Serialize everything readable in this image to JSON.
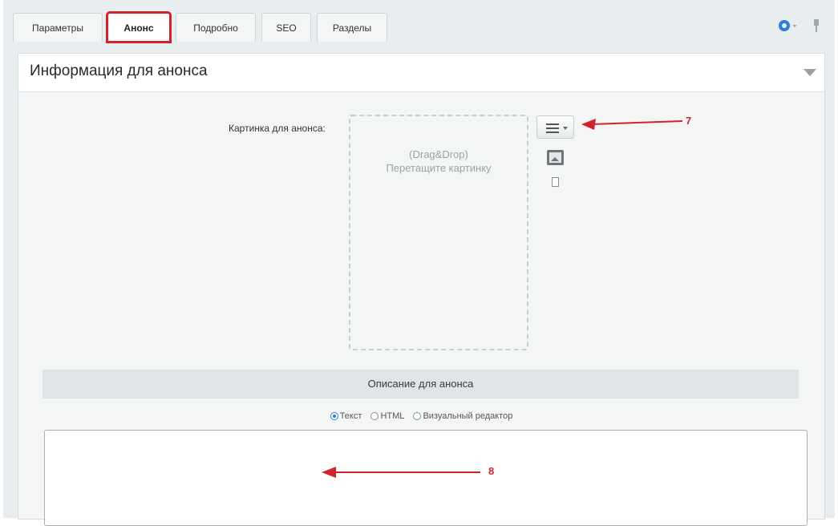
{
  "tabs": [
    {
      "label": "Параметры"
    },
    {
      "label": "Анонс"
    },
    {
      "label": "Подробно"
    },
    {
      "label": "SEO"
    },
    {
      "label": "Разделы"
    }
  ],
  "section": {
    "title": "Информация для анонса"
  },
  "picture": {
    "label": "Картинка для анонса:",
    "dropzone_line1": "(Drag&Drop)",
    "dropzone_line2": "Перетащите картинку"
  },
  "description": {
    "header": "Описание для анонса",
    "modes": [
      {
        "label": "Текст",
        "selected": true
      },
      {
        "label": "HTML",
        "selected": false
      },
      {
        "label": "Визуальный редактор",
        "selected": false
      }
    ],
    "value": ""
  },
  "annotations": {
    "arrow_7": "7",
    "arrow_8": "8"
  },
  "icons": [
    "gear-icon",
    "pin-icon",
    "collapse-triangle-icon",
    "hamburger-menu-icon",
    "image-icon",
    "file-icon"
  ],
  "colors": {
    "highlight": "#d0242a",
    "accent": "#2c7fd3"
  }
}
